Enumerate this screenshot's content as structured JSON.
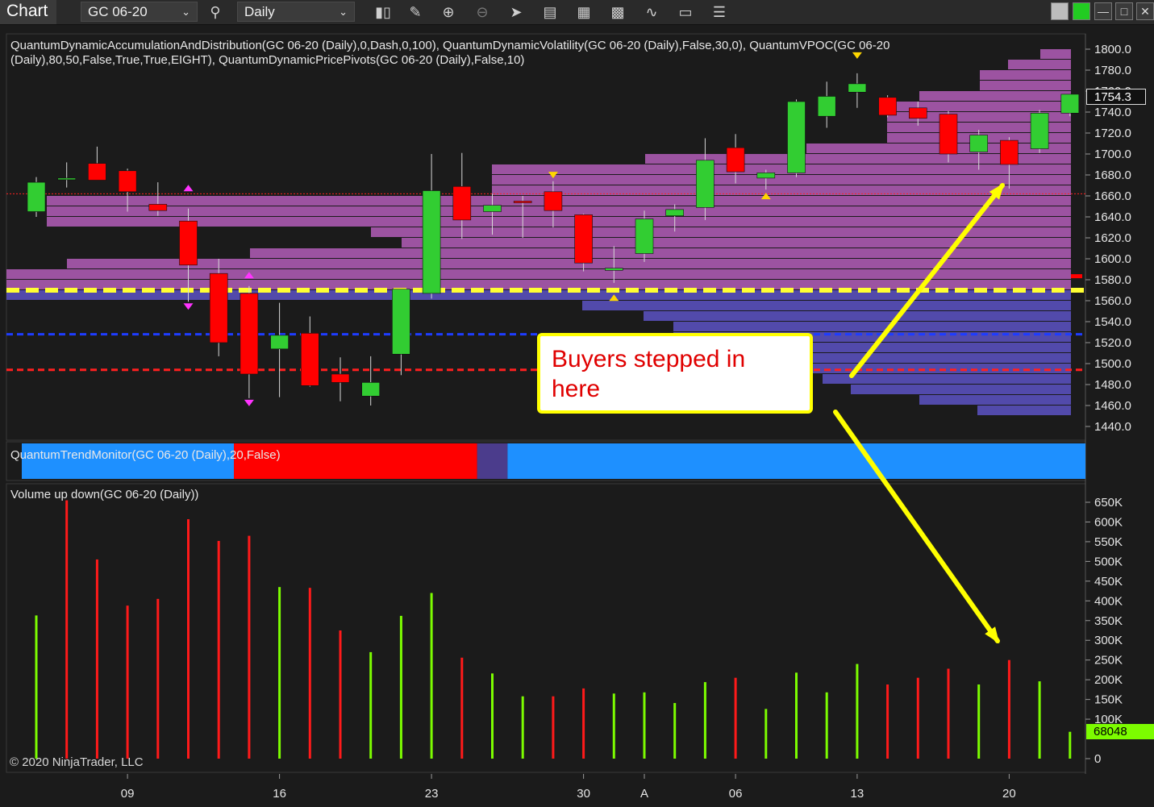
{
  "toolbar": {
    "title": "Chart",
    "instrument": "GC 06-20",
    "interval": "Daily",
    "icons": [
      "search-icon",
      "candlestick-icon",
      "pencil-icon",
      "zoom-in-icon",
      "zoom-out-icon",
      "pointer-icon",
      "data-box-icon",
      "properties-icon",
      "bar-chart-icon",
      "strategy-icon",
      "drawing-objects-icon",
      "list-icon"
    ],
    "accent_green": "#22cc22"
  },
  "price_panel": {
    "indicator_line1": "QuantumDynamicAccumulationAndDistribution(GC 06-20 (Daily),0,Dash,0,100), QuantumDynamicVolatility(GC 06-20 (Daily),False,30,0), QuantumVPOC(GC 06-20",
    "indicator_line2": "(Daily),80,50,False,True,True,EIGHT), QuantumDynamicPricePivots(GC 06-20 (Daily),False,10)",
    "last_price": "1754.3"
  },
  "trend_panel": {
    "label": "QuantumTrendMonitor(GC 06-20 (Daily),20,False)",
    "segments": [
      {
        "from": 0,
        "to": 7,
        "color": "#1e90ff"
      },
      {
        "from": 7,
        "to": 15,
        "color": "#ff0000"
      },
      {
        "from": 15,
        "to": 16,
        "color": "#4b3c8c"
      },
      {
        "from": 16,
        "to": 35,
        "color": "#1e90ff"
      }
    ]
  },
  "volume_panel": {
    "label": "Volume up down(GC 06-20 (Daily))",
    "last_volume": "68048"
  },
  "callout": {
    "line1": "Buyers stepped in",
    "line2": "here"
  },
  "copyright": "© 2020 NinjaTrader, LLC",
  "chart_data": {
    "type": "candlestick",
    "instrument": "GC 06-20",
    "x_tick_labels": [
      {
        "index": 3,
        "label": "09"
      },
      {
        "index": 8,
        "label": "16"
      },
      {
        "index": 13,
        "label": "23"
      },
      {
        "index": 18,
        "label": "30"
      },
      {
        "index": 20,
        "label": "A"
      },
      {
        "index": 23,
        "label": "06"
      },
      {
        "index": 27,
        "label": "13"
      },
      {
        "index": 32,
        "label": "20"
      }
    ],
    "price_ylim": [
      1430,
      1807
    ],
    "price_ticks": [
      1440,
      1460,
      1480,
      1500,
      1520,
      1540,
      1560,
      1580,
      1600,
      1620,
      1640,
      1660,
      1680,
      1700,
      1720,
      1740,
      1760,
      1780,
      1800
    ],
    "candles": [
      {
        "o": 1645,
        "h": 1678,
        "l": 1640,
        "c": 1673
      },
      {
        "o": 1676,
        "h": 1692,
        "l": 1668,
        "c": 1677
      },
      {
        "o": 1691,
        "h": 1707,
        "l": 1675,
        "c": 1675
      },
      {
        "o": 1684,
        "h": 1686,
        "l": 1645,
        "c": 1664
      },
      {
        "o": 1652,
        "h": 1673,
        "l": 1641,
        "c": 1646
      },
      {
        "o": 1636,
        "h": 1648,
        "l": 1559,
        "c": 1594
      },
      {
        "o": 1586,
        "h": 1600,
        "l": 1507,
        "c": 1520
      },
      {
        "o": 1567,
        "h": 1574,
        "l": 1467,
        "c": 1490
      },
      {
        "o": 1514,
        "h": 1558,
        "l": 1468,
        "c": 1527
      },
      {
        "o": 1529,
        "h": 1545,
        "l": 1478,
        "c": 1479
      },
      {
        "o": 1490,
        "h": 1506,
        "l": 1464,
        "c": 1482
      },
      {
        "o": 1469,
        "h": 1507,
        "l": 1460,
        "c": 1482
      },
      {
        "o": 1509,
        "h": 1570,
        "l": 1489,
        "c": 1571
      },
      {
        "o": 1567,
        "h": 1700,
        "l": 1562,
        "c": 1665
      },
      {
        "o": 1669,
        "h": 1701,
        "l": 1619,
        "c": 1637
      },
      {
        "o": 1645,
        "h": 1662,
        "l": 1623,
        "c": 1651
      },
      {
        "o": 1655,
        "h": 1660,
        "l": 1620,
        "c": 1654
      },
      {
        "o": 1664,
        "h": 1674,
        "l": 1630,
        "c": 1646
      },
      {
        "o": 1642,
        "h": 1643,
        "l": 1588,
        "c": 1596
      },
      {
        "o": 1589,
        "h": 1612,
        "l": 1577,
        "c": 1591
      },
      {
        "o": 1605,
        "h": 1646,
        "l": 1597,
        "c": 1638
      },
      {
        "o": 1641,
        "h": 1652,
        "l": 1626,
        "c": 1647
      },
      {
        "o": 1649,
        "h": 1715,
        "l": 1637,
        "c": 1694
      },
      {
        "o": 1706,
        "h": 1719,
        "l": 1672,
        "c": 1683
      },
      {
        "o": 1677,
        "h": 1685,
        "l": 1666,
        "c": 1682
      },
      {
        "o": 1682,
        "h": 1752,
        "l": 1678,
        "c": 1750
      },
      {
        "o": 1736,
        "h": 1769,
        "l": 1725,
        "c": 1755
      },
      {
        "o": 1759,
        "h": 1777,
        "l": 1744,
        "c": 1767
      },
      {
        "o": 1754,
        "h": 1756,
        "l": 1735,
        "c": 1737
      },
      {
        "o": 1744,
        "h": 1750,
        "l": 1727,
        "c": 1734
      },
      {
        "o": 1738,
        "h": 1741,
        "l": 1692,
        "c": 1700
      },
      {
        "o": 1702,
        "h": 1723,
        "l": 1685,
        "c": 1718
      },
      {
        "o": 1713,
        "h": 1716,
        "l": 1667,
        "c": 1690
      },
      {
        "o": 1705,
        "h": 1742,
        "l": 1701,
        "c": 1739
      },
      {
        "o": 1739,
        "h": 1751,
        "l": 1736,
        "c": 1757
      }
    ],
    "volume_ticks": [
      "0",
      "100K",
      "150K",
      "200K",
      "250K",
      "300K",
      "350K",
      "400K",
      "450K",
      "500K",
      "550K",
      "600K",
      "650K"
    ],
    "volume_ylim": [
      0,
      675000
    ],
    "volumes": [
      {
        "v": 363000,
        "dir": "up"
      },
      {
        "v": 655000,
        "dir": "down"
      },
      {
        "v": 505000,
        "dir": "down"
      },
      {
        "v": 388000,
        "dir": "down"
      },
      {
        "v": 405000,
        "dir": "down"
      },
      {
        "v": 607000,
        "dir": "down"
      },
      {
        "v": 552000,
        "dir": "down"
      },
      {
        "v": 565000,
        "dir": "down"
      },
      {
        "v": 435000,
        "dir": "up"
      },
      {
        "v": 433000,
        "dir": "down"
      },
      {
        "v": 325000,
        "dir": "down"
      },
      {
        "v": 270000,
        "dir": "up"
      },
      {
        "v": 362000,
        "dir": "up"
      },
      {
        "v": 420000,
        "dir": "up"
      },
      {
        "v": 256000,
        "dir": "down"
      },
      {
        "v": 216000,
        "dir": "up"
      },
      {
        "v": 158000,
        "dir": "up"
      },
      {
        "v": 158000,
        "dir": "down"
      },
      {
        "v": 178000,
        "dir": "down"
      },
      {
        "v": 165000,
        "dir": "up"
      },
      {
        "v": 168000,
        "dir": "up"
      },
      {
        "v": 141000,
        "dir": "up"
      },
      {
        "v": 194000,
        "dir": "up"
      },
      {
        "v": 205000,
        "dir": "down"
      },
      {
        "v": 126000,
        "dir": "up"
      },
      {
        "v": 218000,
        "dir": "up"
      },
      {
        "v": 168000,
        "dir": "up"
      },
      {
        "v": 240000,
        "dir": "up"
      },
      {
        "v": 188000,
        "dir": "down"
      },
      {
        "v": 205000,
        "dir": "down"
      },
      {
        "v": 228000,
        "dir": "down"
      },
      {
        "v": 188000,
        "dir": "up"
      },
      {
        "v": 250000,
        "dir": "down"
      },
      {
        "v": 196000,
        "dir": "up"
      },
      {
        "v": 68048,
        "dir": "up"
      }
    ],
    "levels": [
      {
        "name": "vpoc",
        "price": 1570,
        "color": "#ffff33",
        "style": "dash"
      },
      {
        "name": "support",
        "price": 1528,
        "color": "#1e3cff",
        "style": "dash"
      },
      {
        "name": "low-band",
        "price": 1494,
        "color": "#ff2020",
        "style": "dash"
      },
      {
        "name": "high-band",
        "price": 1662,
        "color": "#ff2020",
        "style": "dot"
      }
    ],
    "colors": {
      "up": "#32cd32",
      "down": "#ff0000",
      "vol_up": "#7cfc00",
      "vol_down": "#ff1a1a",
      "profile_high": "#c266c2",
      "profile_low": "#6a5acd"
    }
  }
}
